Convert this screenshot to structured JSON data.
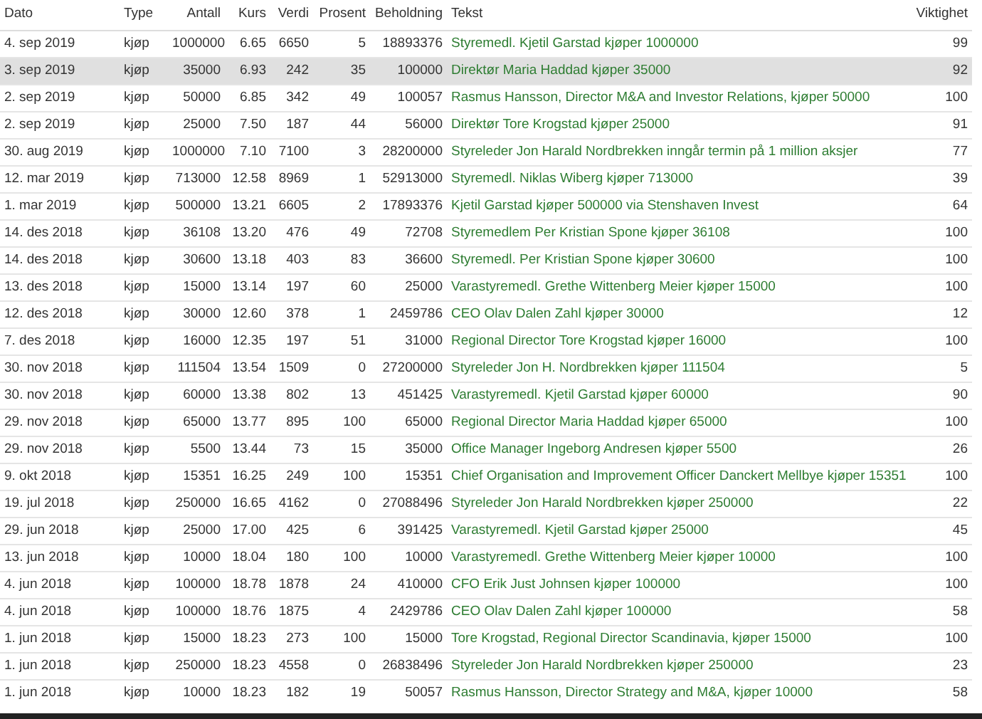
{
  "table": {
    "columns": [
      "Dato",
      "Type",
      "Antall",
      "Kurs",
      "Verdi",
      "Prosent",
      "Beholdning",
      "Tekst",
      "Viktighet"
    ],
    "rows": [
      {
        "selected": false,
        "cells": [
          "4. sep 2019",
          "kjøp",
          "1000000",
          "6.65",
          "6650",
          "5",
          "18893376",
          "Styremedl. Kjetil Garstad kjøper 1000000",
          "99"
        ]
      },
      {
        "selected": true,
        "cells": [
          "3. sep 2019",
          "kjøp",
          "35000",
          "6.93",
          "242",
          "35",
          "100000",
          "Direktør Maria Haddad kjøper 35000",
          "92"
        ]
      },
      {
        "selected": false,
        "cells": [
          "2. sep 2019",
          "kjøp",
          "50000",
          "6.85",
          "342",
          "49",
          "100057",
          "Rasmus Hansson, Director M&A and Investor Relations, kjøper 50000",
          "100"
        ]
      },
      {
        "selected": false,
        "cells": [
          "2. sep 2019",
          "kjøp",
          "25000",
          "7.50",
          "187",
          "44",
          "56000",
          "Direktør Tore Krogstad kjøper 25000",
          "91"
        ]
      },
      {
        "selected": false,
        "cells": [
          "30. aug 2019",
          "kjøp",
          "1000000",
          "7.10",
          "7100",
          "3",
          "28200000",
          "Styreleder Jon Harald Nordbrekken inngår termin på 1 million aksjer",
          "77"
        ]
      },
      {
        "selected": false,
        "cells": [
          "12. mar 2019",
          "kjøp",
          "713000",
          "12.58",
          "8969",
          "1",
          "52913000",
          "Styremedl. Niklas Wiberg kjøper 713000",
          "39"
        ]
      },
      {
        "selected": false,
        "cells": [
          "1. mar 2019",
          "kjøp",
          "500000",
          "13.21",
          "6605",
          "2",
          "17893376",
          "Kjetil Garstad kjøper 500000 via Stenshaven Invest",
          "64"
        ]
      },
      {
        "selected": false,
        "cells": [
          "14. des 2018",
          "kjøp",
          "36108",
          "13.20",
          "476",
          "49",
          "72708",
          "Styremedlem Per Kristian Spone kjøper 36108",
          "100"
        ]
      },
      {
        "selected": false,
        "cells": [
          "14. des 2018",
          "kjøp",
          "30600",
          "13.18",
          "403",
          "83",
          "36600",
          "Styremedl. Per Kristian Spone kjøper 30600",
          "100"
        ]
      },
      {
        "selected": false,
        "cells": [
          "13. des 2018",
          "kjøp",
          "15000",
          "13.14",
          "197",
          "60",
          "25000",
          "Varastyremedl. Grethe Wittenberg Meier kjøper 15000",
          "100"
        ]
      },
      {
        "selected": false,
        "cells": [
          "12. des 2018",
          "kjøp",
          "30000",
          "12.60",
          "378",
          "1",
          "2459786",
          "CEO Olav Dalen Zahl kjøper 30000",
          "12"
        ]
      },
      {
        "selected": false,
        "cells": [
          "7. des 2018",
          "kjøp",
          "16000",
          "12.35",
          "197",
          "51",
          "31000",
          "Regional Director Tore Krogstad kjøper 16000",
          "100"
        ]
      },
      {
        "selected": false,
        "cells": [
          "30. nov 2018",
          "kjøp",
          "111504",
          "13.54",
          "1509",
          "0",
          "27200000",
          "Styreleder Jon H. Nordbrekken kjøper 111504",
          "5"
        ]
      },
      {
        "selected": false,
        "cells": [
          "30. nov 2018",
          "kjøp",
          "60000",
          "13.38",
          "802",
          "13",
          "451425",
          "Varastyremedl. Kjetil Garstad kjøper 60000",
          "90"
        ]
      },
      {
        "selected": false,
        "cells": [
          "29. nov 2018",
          "kjøp",
          "65000",
          "13.77",
          "895",
          "100",
          "65000",
          "Regional Director Maria Haddad kjøper 65000",
          "100"
        ]
      },
      {
        "selected": false,
        "cells": [
          "29. nov 2018",
          "kjøp",
          "5500",
          "13.44",
          "73",
          "15",
          "35000",
          "Office Manager Ingeborg Andresen kjøper 5500",
          "26"
        ]
      },
      {
        "selected": false,
        "cells": [
          "9. okt 2018",
          "kjøp",
          "15351",
          "16.25",
          "249",
          "100",
          "15351",
          "Chief Organisation and Improvement Officer Danckert Mellbye kjøper 15351",
          "100"
        ]
      },
      {
        "selected": false,
        "cells": [
          "19. jul 2018",
          "kjøp",
          "250000",
          "16.65",
          "4162",
          "0",
          "27088496",
          "Styreleder Jon Harald Nordbrekken kjøper 250000",
          "22"
        ]
      },
      {
        "selected": false,
        "cells": [
          "29. jun 2018",
          "kjøp",
          "25000",
          "17.00",
          "425",
          "6",
          "391425",
          "Varastyremedl. Kjetil Garstad kjøper 25000",
          "45"
        ]
      },
      {
        "selected": false,
        "cells": [
          "13. jun 2018",
          "kjøp",
          "10000",
          "18.04",
          "180",
          "100",
          "10000",
          "Varastyremedl. Grethe Wittenberg Meier kjøper 10000",
          "100"
        ]
      },
      {
        "selected": false,
        "cells": [
          "4. jun 2018",
          "kjøp",
          "100000",
          "18.78",
          "1878",
          "24",
          "410000",
          "CFO Erik Just Johnsen kjøper 100000",
          "100"
        ]
      },
      {
        "selected": false,
        "cells": [
          "4. jun 2018",
          "kjøp",
          "100000",
          "18.76",
          "1875",
          "4",
          "2429786",
          "CEO Olav Dalen Zahl kjøper 100000",
          "58"
        ]
      },
      {
        "selected": false,
        "cells": [
          "1. jun 2018",
          "kjøp",
          "15000",
          "18.23",
          "273",
          "100",
          "15000",
          "Tore Krogstad, Regional Director Scandinavia, kjøper 15000",
          "100"
        ]
      },
      {
        "selected": false,
        "cells": [
          "1. jun 2018",
          "kjøp",
          "250000",
          "18.23",
          "4558",
          "0",
          "26838496",
          "Styreleder Jon Harald Nordbrekken kjøper 250000",
          "23"
        ]
      },
      {
        "selected": false,
        "cells": [
          "1. jun 2018",
          "kjøp",
          "10000",
          "18.23",
          "182",
          "19",
          "50057",
          "Rasmus Hansson, Director Strategy and M&A, kjøper 10000",
          "58"
        ]
      }
    ]
  }
}
